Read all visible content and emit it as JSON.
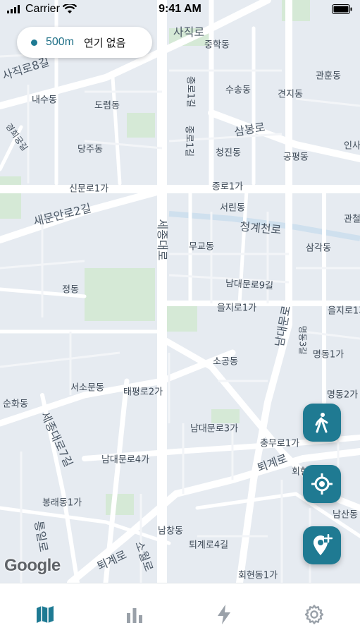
{
  "status_bar": {
    "carrier": "Carrier",
    "time": "9:41 AM"
  },
  "filter_pill": {
    "distance": "500m",
    "status": "연기 없음"
  },
  "map": {
    "attribution": "Google",
    "labels": [
      "사직로",
      "중학동",
      "사직로8길",
      "관훈동",
      "수송동",
      "견지동",
      "내수동",
      "도렴동",
      "종로1길",
      "삼봉로",
      "경희궁길",
      "당주동",
      "청진동",
      "공평동",
      "인사",
      "신문로1가",
      "종로1가",
      "새문안로2길",
      "서린동",
      "관철",
      "청계천로",
      "세종대로",
      "무교동",
      "삼각동",
      "정동",
      "남대문로9길",
      "을지로1가",
      "을지로1가",
      "남대문로",
      "명동3길",
      "명동1가",
      "소공동",
      "서소문동",
      "태평로2가",
      "명동2가",
      "순화동",
      "세종대로7길",
      "남대문로3가",
      "충무로1가",
      "남대문로4가",
      "퇴계로",
      "회현",
      "봉래동1가",
      "남산동",
      "남창동",
      "퇴계로4길",
      "퇴계로",
      "소월로",
      "통일로",
      "회현동1가",
      "종로1길",
      "종로1길"
    ]
  },
  "buttons": {
    "walk": {
      "icon": "walk-icon"
    },
    "locate": {
      "icon": "locate-icon"
    },
    "add_location": {
      "icon": "add-location-icon"
    }
  },
  "tabs": [
    {
      "icon": "map-icon",
      "active": true
    },
    {
      "icon": "bar-chart-icon",
      "active": false
    },
    {
      "icon": "lightning-icon",
      "active": false
    },
    {
      "icon": "gear-icon",
      "active": false
    }
  ],
  "colors": {
    "accent": "#1f7a92",
    "tab_active": "#1e7a93",
    "tab_inactive": "#9aa1a9",
    "map_bg": "#e6ebf1",
    "park": "#d5e9d6"
  }
}
